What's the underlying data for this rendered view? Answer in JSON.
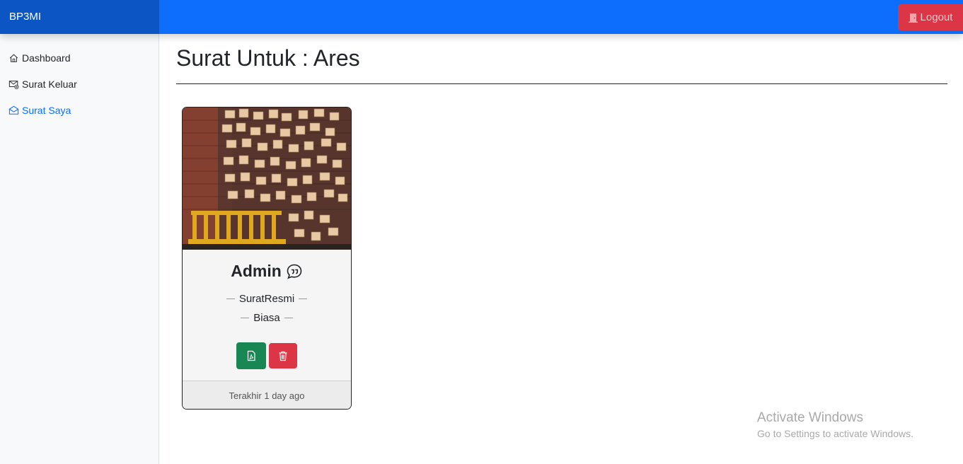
{
  "header": {
    "brand": "BP3MI",
    "logout_label": "Logout",
    "logout_icon": "door-icon",
    "accent_color": "#0d6efd",
    "danger_color": "#dc3545"
  },
  "sidebar": {
    "items": [
      {
        "label": "Dashboard",
        "icon": "house-icon",
        "active": false
      },
      {
        "label": "Surat Keluar",
        "icon": "envelope-x-icon",
        "active": false
      },
      {
        "label": "Surat Saya",
        "icon": "envelope-open-icon",
        "active": true
      }
    ]
  },
  "main": {
    "title": "Surat Untuk : Ares",
    "cards": [
      {
        "sender": "Admin",
        "sender_icon": "chat-quote-icon",
        "type": "SuratResmi",
        "priority": "Biasa",
        "pdf_icon": "file-pdf-icon",
        "delete_icon": "trash-icon",
        "footer": "Terakhir 1 day ago"
      }
    ]
  },
  "watermark": {
    "title": "Activate Windows",
    "subtitle": "Go to Settings to activate Windows."
  }
}
